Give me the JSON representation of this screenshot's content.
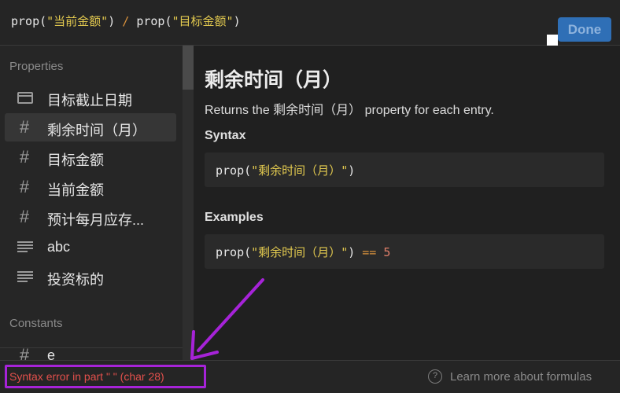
{
  "formula": {
    "fn1": "prop(",
    "arg1": "\"当前金额\"",
    "close1": ")",
    "op": "/",
    "fn2": "prop(",
    "arg2": "\"目标金额\"",
    "close2": ")"
  },
  "toolbar": {
    "done_label": "Done"
  },
  "sidebar": {
    "properties_label": "Properties",
    "properties": [
      {
        "icon": "calendar-icon",
        "label": "目标截止日期"
      },
      {
        "icon": "hash-icon",
        "glyph": "#",
        "label": "剩余时间（月）"
      },
      {
        "icon": "hash-icon",
        "glyph": "#",
        "label": "目标金额"
      },
      {
        "icon": "hash-icon",
        "glyph": "#",
        "label": "当前金额"
      },
      {
        "icon": "hash-icon",
        "glyph": "#",
        "label": "预计每月应存..."
      },
      {
        "icon": "text-lines-icon",
        "label": "abc"
      },
      {
        "icon": "text-lines-icon",
        "label": "投资标的"
      }
    ],
    "selected_index": 1,
    "constants_label": "Constants",
    "constants": [
      {
        "icon": "hash-icon",
        "glyph": "#",
        "label": "e"
      }
    ]
  },
  "detail": {
    "title": "剩余时间（月）",
    "description": "Returns the 剩余时间（月） property for each entry.",
    "syntax_label": "Syntax",
    "syntax": {
      "fn": "prop(",
      "arg": "\"剩余时间（月）\"",
      "close": ")"
    },
    "examples_label": "Examples",
    "example": {
      "fn": "prop(",
      "arg": "\"剩余时间（月）\"",
      "close": ")",
      "op": "==",
      "value": "5"
    }
  },
  "footer": {
    "error_message": "Syntax error in part \" \" (char 28)",
    "help_glyph": "?",
    "help_link": "Learn more about formulas"
  },
  "colors": {
    "annotation": "#a623d8",
    "error": "#e2504c",
    "string": "#e2c94f",
    "operator": "#d8913c",
    "accent": "#2f6fb6"
  }
}
